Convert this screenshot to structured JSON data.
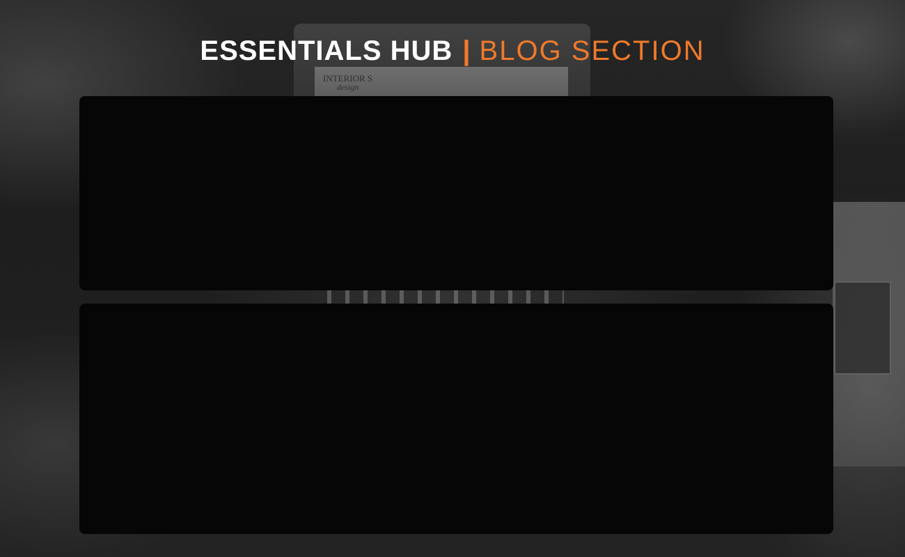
{
  "header": {
    "title_primary": "ESSENTIALS HUB",
    "separator": "|",
    "title_secondary": "BLOG SECTION"
  },
  "background": {
    "screen_heading": "INTERIOR S",
    "screen_subheading": "design"
  },
  "colors": {
    "accent": "#f07a2a",
    "card": "#060606",
    "title": "#ffffff"
  },
  "cards": [
    {
      "content": ""
    },
    {
      "content": ""
    }
  ]
}
